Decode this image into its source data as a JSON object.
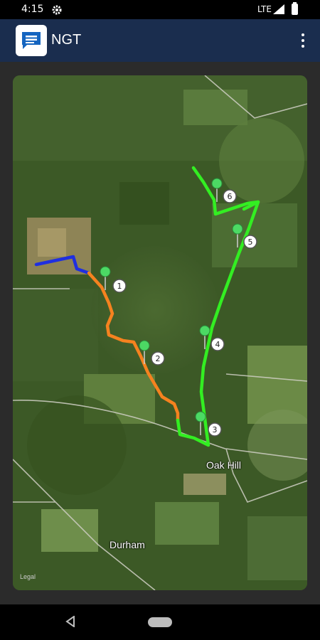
{
  "status_bar": {
    "time": "4:15",
    "network": "LTE",
    "icons": [
      "gear-icon",
      "signal-icon",
      "battery-icon"
    ]
  },
  "app_bar": {
    "title": "NGT",
    "logo_icon": "message-square-icon",
    "menu_icon": "overflow-menu-icon"
  },
  "map": {
    "place_labels": {
      "oak_hill": "Oak Hill",
      "durham": "Durham"
    },
    "legal": "Legal",
    "waypoints": [
      {
        "label": "1"
      },
      {
        "label": "2"
      },
      {
        "label": "3"
      },
      {
        "label": "4"
      },
      {
        "label": "5"
      },
      {
        "label": "6"
      }
    ],
    "route_colors": {
      "blue": "#1f2fe0",
      "orange": "#f5821f",
      "green": "#33ee22"
    }
  },
  "nav_bar": {
    "icons": [
      "back-icon",
      "home-icon"
    ]
  }
}
